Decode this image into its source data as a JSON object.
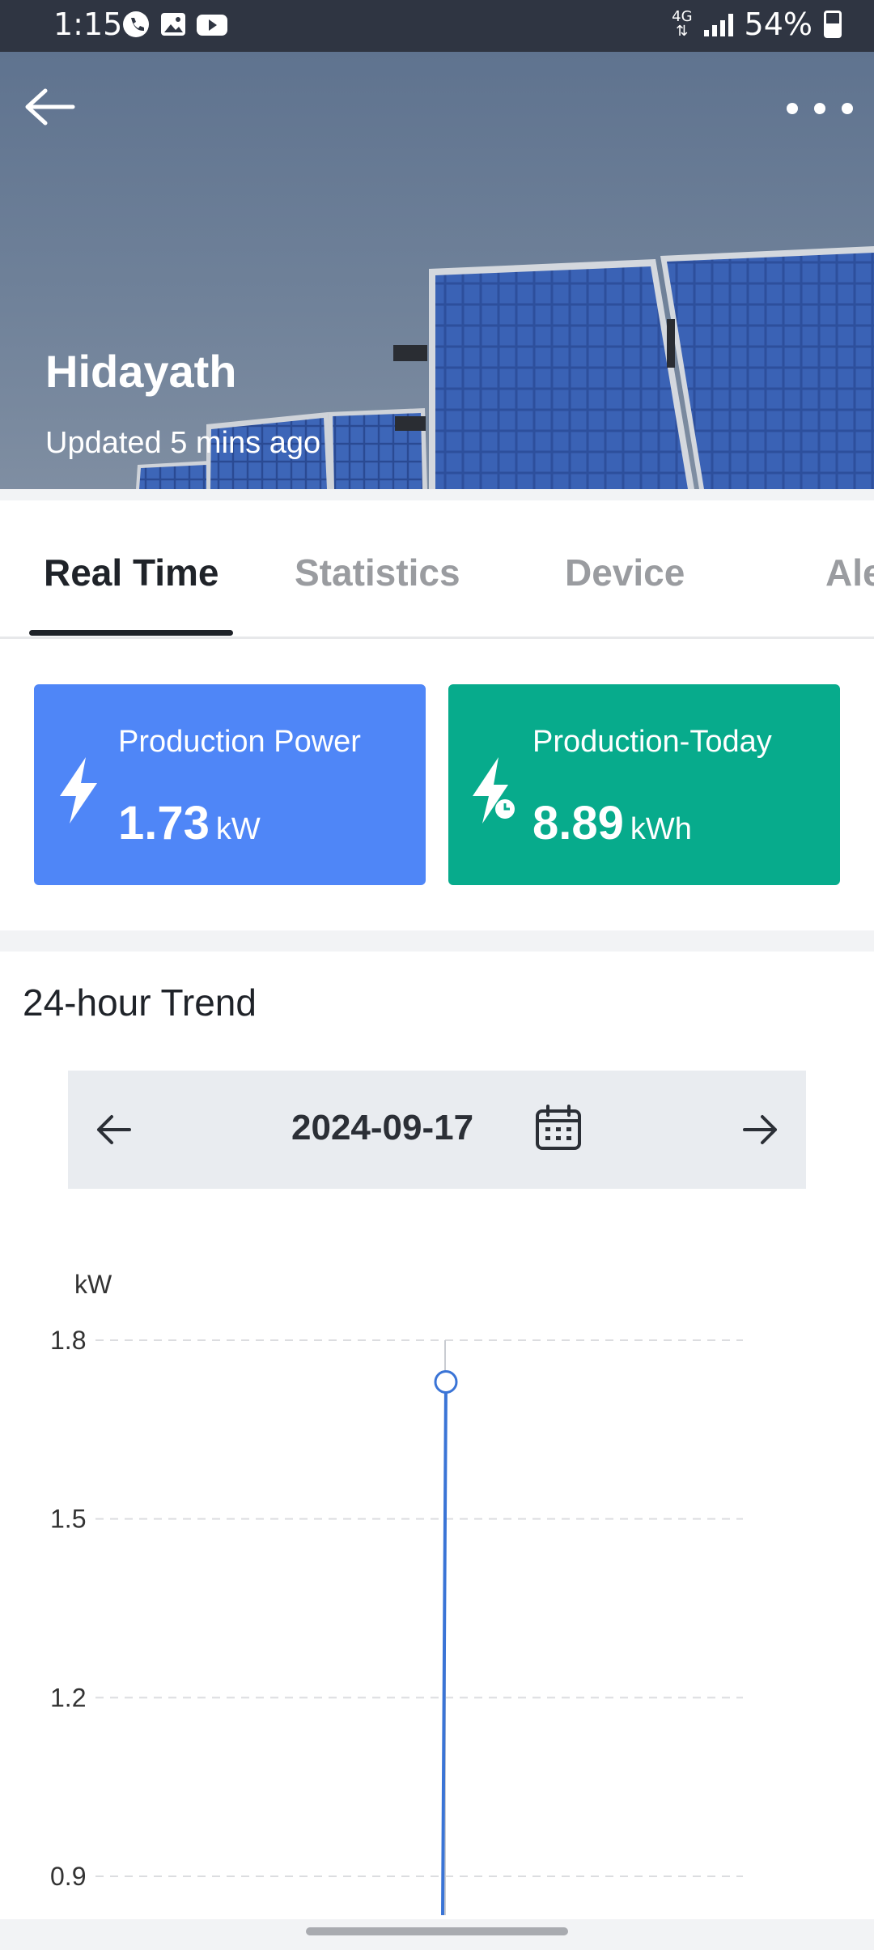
{
  "status_bar": {
    "time": "1:15",
    "network": "4G",
    "battery": "54%",
    "notification_icons": [
      "phone-icon",
      "image-icon",
      "youtube-icon"
    ]
  },
  "hero": {
    "title": "Hidayath",
    "subtitle": "Updated 5 mins ago"
  },
  "tabs": [
    {
      "label": "Real Time",
      "active": true
    },
    {
      "label": "Statistics",
      "active": false
    },
    {
      "label": "Device",
      "active": false
    },
    {
      "label": "Ale",
      "active": false
    }
  ],
  "cards": {
    "power": {
      "label": "Production Power",
      "value": "1.73",
      "unit": "kW",
      "color": "#4f86f7",
      "icon": "lightning-icon"
    },
    "today": {
      "label": "Production-Today",
      "value": "8.89",
      "unit": "kWh",
      "color": "#07ab8c",
      "icon": "lightning-clock-icon"
    }
  },
  "trend": {
    "title": "24-hour Trend",
    "date": "2024-09-17"
  },
  "chart_data": {
    "type": "line",
    "ylabel": "kW",
    "yticks": [
      "1.8",
      "1.5",
      "1.2",
      "0.9"
    ],
    "ylim": [
      0.9,
      1.8
    ],
    "grid": true,
    "series": [
      {
        "points": [
          {
            "y": 0.85
          },
          {
            "y": 1.2
          },
          {
            "y": 1.73
          }
        ],
        "marker_value": 1.73,
        "color": "#3a74d6"
      }
    ]
  }
}
